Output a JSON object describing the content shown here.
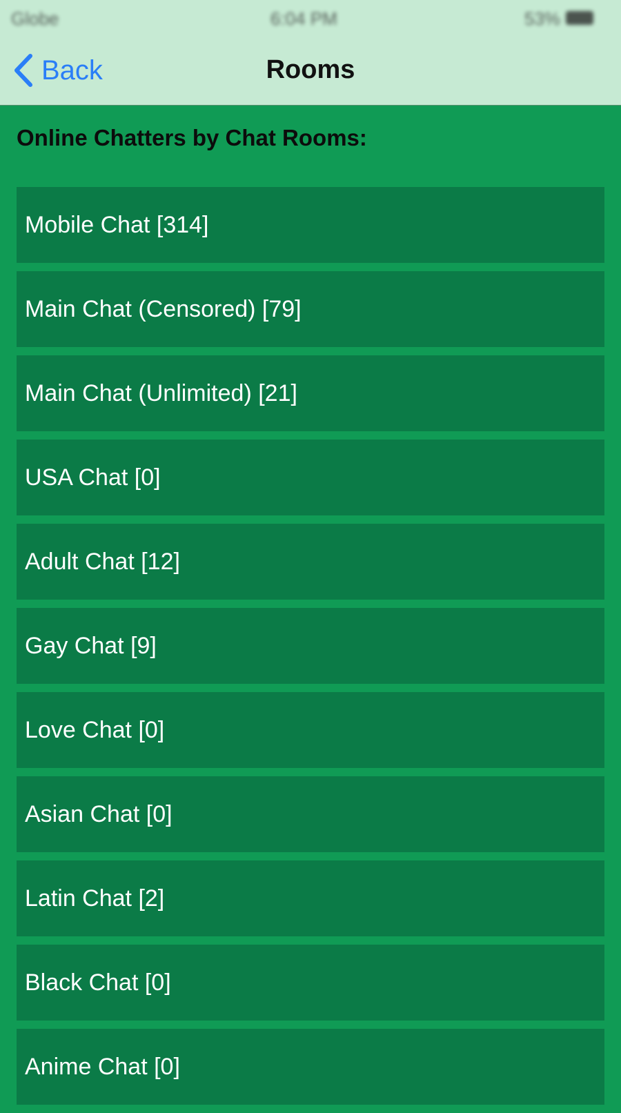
{
  "status_bar": {
    "carrier": "Globe",
    "time": "6:04 PM",
    "battery": "53%"
  },
  "nav": {
    "back_label": "Back",
    "title": "Rooms"
  },
  "section": {
    "heading": "Online Chatters by Chat Rooms:"
  },
  "rooms": [
    {
      "label": "Mobile Chat [314]"
    },
    {
      "label": "Main Chat (Censored) [79]"
    },
    {
      "label": "Main Chat (Unlimited) [21]"
    },
    {
      "label": "USA Chat [0]"
    },
    {
      "label": "Adult Chat [12]"
    },
    {
      "label": "Gay Chat [9]"
    },
    {
      "label": "Love Chat [0]"
    },
    {
      "label": "Asian Chat [0]"
    },
    {
      "label": "Latin Chat [2]"
    },
    {
      "label": "Black Chat [0]"
    },
    {
      "label": "Anime Chat [0]"
    }
  ],
  "colors": {
    "header_bg": "#c6ead3",
    "page_bg": "#109b55",
    "row_bg": "#0b7b47",
    "back_accent": "#2a7ef7"
  },
  "icons": {
    "back": "chevron-left-icon"
  }
}
